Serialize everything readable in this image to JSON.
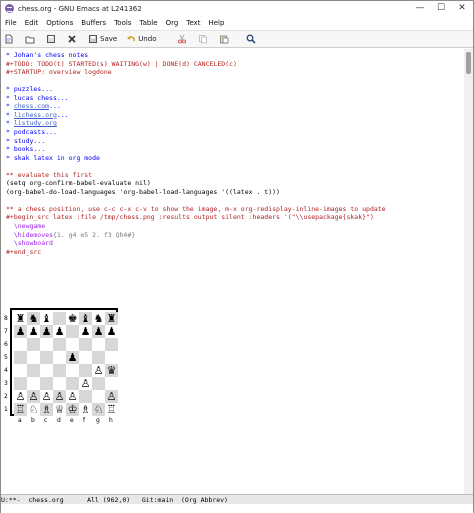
{
  "window": {
    "title": "chess.org - GNU Emacs at L241362",
    "minimize": "—",
    "maximize": "☐",
    "close": "✕"
  },
  "menu": [
    "File",
    "Edit",
    "Options",
    "Buffers",
    "Tools",
    "Table",
    "Org",
    "Text",
    "Help"
  ],
  "toolbar": {
    "save_label": "Save",
    "undo_label": "Undo"
  },
  "lines": [
    {
      "row": 0,
      "parts": [
        {
          "t": "* Johan's chess notes",
          "c": "blue"
        }
      ]
    },
    {
      "row": 1,
      "parts": [
        {
          "t": "#+TODO: TODO(t) STARTED(s) WAITING(w) | DONE(d) CANCELED(c)",
          "c": "red"
        }
      ]
    },
    {
      "row": 2,
      "parts": [
        {
          "t": "#+STARTUP: overview logdone",
          "c": "red"
        }
      ]
    },
    {
      "row": 4,
      "parts": [
        {
          "t": "* puzzles...",
          "c": "blue"
        }
      ]
    },
    {
      "row": 5,
      "parts": [
        {
          "t": "* lucas chess...",
          "c": "blue"
        }
      ]
    },
    {
      "row": 6,
      "parts": [
        {
          "t": "* ",
          "c": "blue"
        },
        {
          "t": "chess.com",
          "c": "link"
        },
        {
          "t": "...",
          "c": "blue"
        }
      ]
    },
    {
      "row": 7,
      "parts": [
        {
          "t": "* ",
          "c": "blue"
        },
        {
          "t": "lichess.org",
          "c": "link"
        },
        {
          "t": "...",
          "c": "blue"
        }
      ]
    },
    {
      "row": 8,
      "parts": [
        {
          "t": "* ",
          "c": "blue"
        },
        {
          "t": "listudy.org",
          "c": "link"
        }
      ]
    },
    {
      "row": 9,
      "parts": [
        {
          "t": "* podcasts...",
          "c": "blue"
        }
      ]
    },
    {
      "row": 10,
      "parts": [
        {
          "t": "* study...",
          "c": "blue"
        }
      ]
    },
    {
      "row": 11,
      "parts": [
        {
          "t": "* books...",
          "c": "blue"
        }
      ]
    },
    {
      "row": 12,
      "parts": [
        {
          "t": "* skak latex in org mode",
          "c": "blue"
        }
      ]
    },
    {
      "row": 14,
      "parts": [
        {
          "t": "** evaluate this first",
          "c": "cm"
        }
      ]
    },
    {
      "row": 15,
      "parts": [
        {
          "t": "(setq org-confirm-babel-evaluate nil)",
          "c": "dk"
        }
      ]
    },
    {
      "row": 16,
      "parts": [
        {
          "t": "(org-babel-do-load-languages 'org-babel-load-languages '((latex . t)))",
          "c": "dk"
        }
      ]
    },
    {
      "row": 18,
      "parts": [
        {
          "t": "** a chess position, use c-c c-x c-v to show the image, m-x org-redisplay-inline-images to update",
          "c": "cm"
        }
      ]
    },
    {
      "row": 19,
      "parts": [
        {
          "t": "#+begin_src latex :file /tmp/chess.png :results output silent :headers '(\"\\\\usepackage{skak}\")",
          "c": "red"
        }
      ]
    },
    {
      "row": 20,
      "parts": [
        {
          "t": "  \\newgame",
          "c": "pur"
        }
      ]
    },
    {
      "row": 21,
      "parts": [
        {
          "t": "  \\hidemoves",
          "c": "pur"
        },
        {
          "t": "{1. g4 e5 2. f3 Qh4#}",
          "c": "dim"
        }
      ]
    },
    {
      "row": 22,
      "parts": [
        {
          "t": "  \\showboard",
          "c": "pur"
        }
      ]
    },
    {
      "row": 23,
      "parts": [
        {
          "t": "#+end_src",
          "c": "red"
        }
      ]
    }
  ],
  "board": {
    "ranks": [
      "8",
      "7",
      "6",
      "5",
      "4",
      "3",
      "2",
      "1"
    ],
    "files": [
      "a",
      "b",
      "c",
      "d",
      "e",
      "f",
      "g",
      "h"
    ],
    "rows": [
      [
        "♜",
        "♞",
        "♝",
        "",
        "♚",
        "♝",
        "♞",
        "♜"
      ],
      [
        "♟",
        "♟",
        "♟",
        "♟",
        "",
        "♟",
        "♟",
        "♟"
      ],
      [
        "",
        "",
        "",
        "",
        "",
        "",
        "",
        ""
      ],
      [
        "",
        "",
        "",
        "",
        "♟",
        "",
        "",
        ""
      ],
      [
        "",
        "",
        "",
        "",
        "",
        "",
        "♙",
        "♛"
      ],
      [
        "",
        "",
        "",
        "",
        "",
        "♙",
        "",
        ""
      ],
      [
        "♙",
        "♙",
        "♙",
        "♙",
        "♙",
        "",
        "",
        "♙"
      ],
      [
        "♖",
        "♘",
        "♗",
        "♕",
        "♔",
        "♗",
        "♘",
        "♖"
      ]
    ]
  },
  "modeline": "U:**-  chess.org      All (962,0)   Git:main  (Org Abbrev)"
}
